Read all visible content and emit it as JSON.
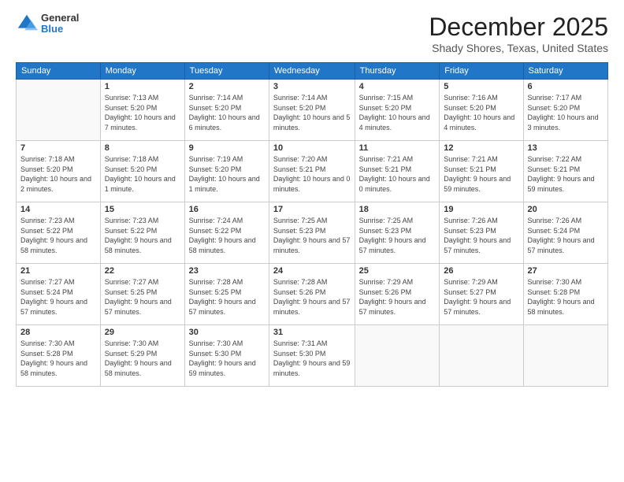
{
  "header": {
    "logo": {
      "general": "General",
      "blue": "Blue"
    },
    "title": "December 2025",
    "location": "Shady Shores, Texas, United States"
  },
  "weekdays": [
    "Sunday",
    "Monday",
    "Tuesday",
    "Wednesday",
    "Thursday",
    "Friday",
    "Saturday"
  ],
  "weeks": [
    [
      {
        "num": "",
        "empty": true
      },
      {
        "num": "1",
        "rise": "7:13 AM",
        "set": "5:20 PM",
        "daylight": "10 hours and 7 minutes."
      },
      {
        "num": "2",
        "rise": "7:14 AM",
        "set": "5:20 PM",
        "daylight": "10 hours and 6 minutes."
      },
      {
        "num": "3",
        "rise": "7:14 AM",
        "set": "5:20 PM",
        "daylight": "10 hours and 5 minutes."
      },
      {
        "num": "4",
        "rise": "7:15 AM",
        "set": "5:20 PM",
        "daylight": "10 hours and 4 minutes."
      },
      {
        "num": "5",
        "rise": "7:16 AM",
        "set": "5:20 PM",
        "daylight": "10 hours and 4 minutes."
      },
      {
        "num": "6",
        "rise": "7:17 AM",
        "set": "5:20 PM",
        "daylight": "10 hours and 3 minutes."
      }
    ],
    [
      {
        "num": "7",
        "rise": "7:18 AM",
        "set": "5:20 PM",
        "daylight": "10 hours and 2 minutes."
      },
      {
        "num": "8",
        "rise": "7:18 AM",
        "set": "5:20 PM",
        "daylight": "10 hours and 1 minute."
      },
      {
        "num": "9",
        "rise": "7:19 AM",
        "set": "5:20 PM",
        "daylight": "10 hours and 1 minute."
      },
      {
        "num": "10",
        "rise": "7:20 AM",
        "set": "5:21 PM",
        "daylight": "10 hours and 0 minutes."
      },
      {
        "num": "11",
        "rise": "7:21 AM",
        "set": "5:21 PM",
        "daylight": "10 hours and 0 minutes."
      },
      {
        "num": "12",
        "rise": "7:21 AM",
        "set": "5:21 PM",
        "daylight": "9 hours and 59 minutes."
      },
      {
        "num": "13",
        "rise": "7:22 AM",
        "set": "5:21 PM",
        "daylight": "9 hours and 59 minutes."
      }
    ],
    [
      {
        "num": "14",
        "rise": "7:23 AM",
        "set": "5:22 PM",
        "daylight": "9 hours and 58 minutes."
      },
      {
        "num": "15",
        "rise": "7:23 AM",
        "set": "5:22 PM",
        "daylight": "9 hours and 58 minutes."
      },
      {
        "num": "16",
        "rise": "7:24 AM",
        "set": "5:22 PM",
        "daylight": "9 hours and 58 minutes."
      },
      {
        "num": "17",
        "rise": "7:25 AM",
        "set": "5:23 PM",
        "daylight": "9 hours and 57 minutes."
      },
      {
        "num": "18",
        "rise": "7:25 AM",
        "set": "5:23 PM",
        "daylight": "9 hours and 57 minutes."
      },
      {
        "num": "19",
        "rise": "7:26 AM",
        "set": "5:23 PM",
        "daylight": "9 hours and 57 minutes."
      },
      {
        "num": "20",
        "rise": "7:26 AM",
        "set": "5:24 PM",
        "daylight": "9 hours and 57 minutes."
      }
    ],
    [
      {
        "num": "21",
        "rise": "7:27 AM",
        "set": "5:24 PM",
        "daylight": "9 hours and 57 minutes."
      },
      {
        "num": "22",
        "rise": "7:27 AM",
        "set": "5:25 PM",
        "daylight": "9 hours and 57 minutes."
      },
      {
        "num": "23",
        "rise": "7:28 AM",
        "set": "5:25 PM",
        "daylight": "9 hours and 57 minutes."
      },
      {
        "num": "24",
        "rise": "7:28 AM",
        "set": "5:26 PM",
        "daylight": "9 hours and 57 minutes."
      },
      {
        "num": "25",
        "rise": "7:29 AM",
        "set": "5:26 PM",
        "daylight": "9 hours and 57 minutes."
      },
      {
        "num": "26",
        "rise": "7:29 AM",
        "set": "5:27 PM",
        "daylight": "9 hours and 57 minutes."
      },
      {
        "num": "27",
        "rise": "7:30 AM",
        "set": "5:28 PM",
        "daylight": "9 hours and 58 minutes."
      }
    ],
    [
      {
        "num": "28",
        "rise": "7:30 AM",
        "set": "5:28 PM",
        "daylight": "9 hours and 58 minutes."
      },
      {
        "num": "29",
        "rise": "7:30 AM",
        "set": "5:29 PM",
        "daylight": "9 hours and 58 minutes."
      },
      {
        "num": "30",
        "rise": "7:30 AM",
        "set": "5:30 PM",
        "daylight": "9 hours and 59 minutes."
      },
      {
        "num": "31",
        "rise": "7:31 AM",
        "set": "5:30 PM",
        "daylight": "9 hours and 59 minutes."
      },
      {
        "num": "",
        "empty": true
      },
      {
        "num": "",
        "empty": true
      },
      {
        "num": "",
        "empty": true
      }
    ]
  ]
}
